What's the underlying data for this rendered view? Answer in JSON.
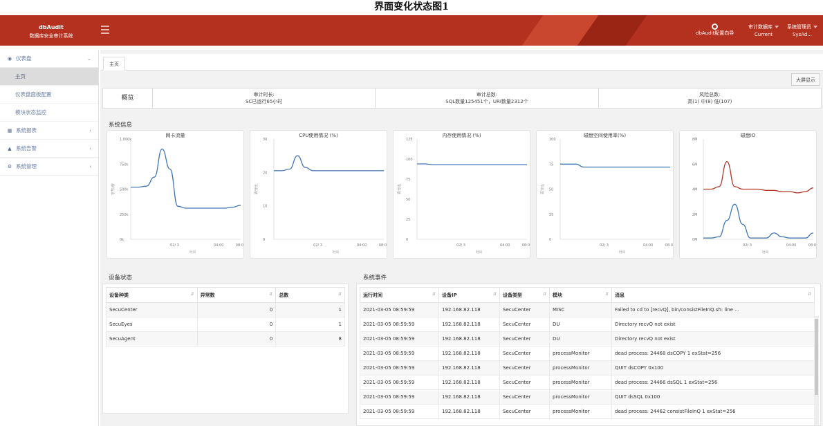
{
  "caption": "界面变化状态图1",
  "header": {
    "brand_title": "dbAudit",
    "brand_subtitle": "数据库安全审计系统",
    "guide_label": "dbAudit配置向导",
    "audit_db_label": "审计数据库",
    "audit_db_value": "Current",
    "admin_label": "系统管理员",
    "admin_value": "SysAd..."
  },
  "sidebar": {
    "dashboard": "仪表盘",
    "home": "主页",
    "dashboard_config": "仪表盘面板配置",
    "module_monitor": "模块状态监控",
    "reports": "系统报表",
    "alerts": "系统告警",
    "admin": "系统管理"
  },
  "tab": {
    "home": "主页"
  },
  "bigscreen_label": "大屏显示",
  "overview": {
    "title": "概览",
    "audit_time_label": "审计时长:",
    "audit_time_value": "SC已运行65小时",
    "audit_total_label": "审计总数:",
    "audit_total_value": "SQL数量125451个，URI数量2312个",
    "risk_label": "风险总数:",
    "risk_value": "高(1) 中(8) 低(107)"
  },
  "sysinfo_title": "系统信息",
  "colors": {
    "blue": "#3f74b6",
    "red": "#b13424",
    "header": "#b4301f"
  },
  "charts": [
    {
      "title": "网卡流量",
      "ylabel": "字节/秒",
      "xlabel": "时间",
      "yticks": [
        "1,000k",
        "750k",
        "500k",
        "250k",
        "0k"
      ],
      "xticks": [
        "02/ 3",
        "04:00",
        "08:00"
      ],
      "ymax": 1000,
      "series": [
        {
          "color": "#3f74b6",
          "values": [
            520,
            520,
            530,
            620,
            900,
            700,
            330,
            310,
            310,
            310,
            310,
            310,
            310,
            320,
            340
          ]
        }
      ]
    },
    {
      "title": "CPU使用情况 (%)",
      "ylabel": "百分比",
      "xlabel": "时间",
      "yticks": [
        "30",
        "20",
        "10",
        "0"
      ],
      "xticks": [
        "02/ 3",
        "04:00",
        "08:00"
      ],
      "ymax": 30,
      "series": [
        {
          "color": "#3f74b6",
          "values": [
            20.5,
            20.5,
            21,
            25,
            21.5,
            20.5,
            20.5,
            20.5,
            20.5,
            20.5,
            20.5,
            20.5,
            20.5,
            20.5,
            20.5
          ]
        }
      ]
    },
    {
      "title": "内存使用情况 (%)",
      "ylabel": "百分比",
      "xlabel": "时间",
      "yticks": [
        "125",
        "100",
        "75",
        "50",
        "25",
        "0"
      ],
      "xticks": [
        "02/ 3",
        "04:00",
        "08:00"
      ],
      "ymax": 125,
      "series": [
        {
          "color": "#3f74b6",
          "values": [
            94,
            94,
            93,
            93,
            93,
            93,
            93,
            93,
            93,
            93,
            93,
            93,
            93,
            93,
            93
          ]
        }
      ]
    },
    {
      "title": "磁盘空间使用率(%)",
      "ylabel": "百分比",
      "xlabel": "时间",
      "yticks": [
        "100",
        "75",
        "50",
        "25",
        "0"
      ],
      "xticks": [
        "02/ 3",
        "04:00",
        "08:00"
      ],
      "ymax": 100,
      "series": [
        {
          "color": "#3f74b6",
          "values": [
            75,
            75,
            75,
            72,
            72,
            72,
            72,
            72,
            72,
            72,
            72,
            72,
            72,
            72,
            72
          ]
        }
      ]
    },
    {
      "title": "磁盘IO",
      "ylabel": "",
      "xlabel": "时间",
      "yticks": [
        "8M",
        "6M",
        "4M",
        "2M",
        "0M"
      ],
      "xticks": [
        "02/ 3",
        "04:00",
        "08:00"
      ],
      "ymax": 8,
      "series": [
        {
          "color": "#b13424",
          "values": [
            4.0,
            4.0,
            4.2,
            6.2,
            4.2,
            4.0,
            4.0,
            4.0,
            3.9,
            3.9,
            3.8,
            3.8,
            3.7,
            3.8,
            4.1
          ]
        },
        {
          "color": "#3f74b6",
          "values": [
            0.1,
            0.1,
            0.2,
            1.5,
            2.8,
            1.2,
            0.1,
            0.1,
            0.1,
            0.5,
            0.2,
            0.1,
            0.1,
            0.1,
            0.5
          ]
        }
      ]
    }
  ],
  "device_status": {
    "title": "设备状态",
    "headers": [
      "设备种类",
      "异常数",
      "总数"
    ],
    "rows": [
      [
        "SecuCenter",
        "0",
        "1"
      ],
      [
        "SecuEyes",
        "0",
        "1"
      ],
      [
        "SecuAgent",
        "0",
        "8"
      ]
    ]
  },
  "system_events": {
    "title": "系统事件",
    "headers": [
      "运行时间",
      "设备IP",
      "设备类型",
      "模块",
      "消息"
    ],
    "rows": [
      [
        "2021-03-05 08:59:59",
        "192.168.82.118",
        "SecuCenter",
        "MISC",
        "Failed to cd to [recvQ], bin/consistFileInQ.sh: line ..."
      ],
      [
        "2021-03-05 08:59:59",
        "192.168.82.118",
        "SecuCenter",
        "DU",
        "Directory recvQ not exist"
      ],
      [
        "2021-03-05 08:59:59",
        "192.168.82.118",
        "SecuCenter",
        "DU",
        "Directory recvQ not exist"
      ],
      [
        "2021-03-05 08:59:59",
        "192.168.82.118",
        "SecuCenter",
        "processMonitor",
        "dead process: 24468 dsCOPY 1 exStat=256"
      ],
      [
        "2021-03-05 08:59:59",
        "192.168.82.118",
        "SecuCenter",
        "processMonitor",
        "QUIT dsCOPY 0x100"
      ],
      [
        "2021-03-05 08:59:59",
        "192.168.82.118",
        "SecuCenter",
        "processMonitor",
        "dead process: 24466 dsSQL 1 exStat=256"
      ],
      [
        "2021-03-05 08:59:59",
        "192.168.82.118",
        "SecuCenter",
        "processMonitor",
        "QUIT dsSQL 0x100"
      ],
      [
        "2021-03-05 08:59:59",
        "192.168.82.118",
        "SecuCenter",
        "processMonitor",
        "dead process: 24462 consistFileInQ 1 exStat=256"
      ]
    ]
  }
}
